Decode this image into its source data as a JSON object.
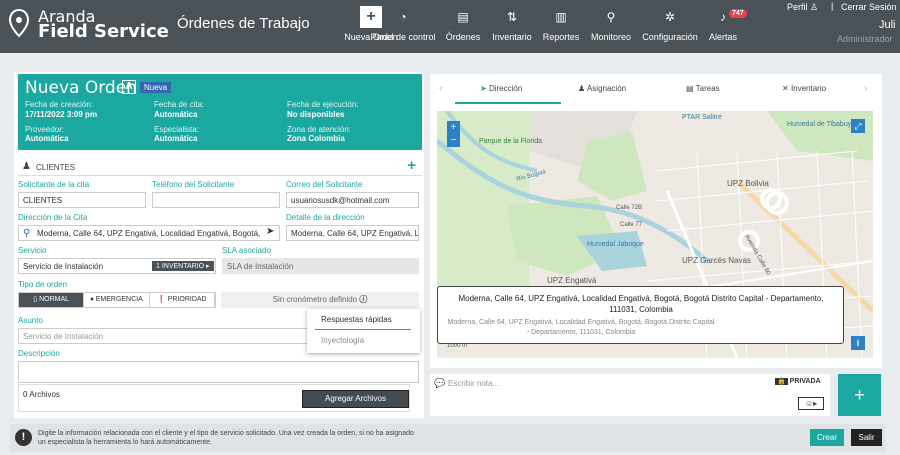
{
  "app": {
    "brand_line1": "Aranda",
    "brand_line2": "Field Service",
    "page_title": "Órdenes de Trabajo"
  },
  "nav": [
    {
      "label": "Nueva Orden",
      "icon": "plus-icon"
    },
    {
      "label": "Panel de control",
      "icon": "dashboard-icon"
    },
    {
      "label": "Órdenes",
      "icon": "orders-icon"
    },
    {
      "label": "Inventario",
      "icon": "inventory-icon"
    },
    {
      "label": "Reportes",
      "icon": "reports-icon"
    },
    {
      "label": "Monitoreo",
      "icon": "monitor-icon"
    },
    {
      "label": "Configuración",
      "icon": "gear-icon"
    },
    {
      "label": "Alertas",
      "icon": "bell-icon"
    }
  ],
  "alerts_count": "747",
  "user": {
    "perfil": "Perfil",
    "cerrar": "Cerrar Sesión",
    "name": "Juli",
    "role": "Administrador"
  },
  "order": {
    "title": "Nueva Orden",
    "letter": "A",
    "status": "Nueva",
    "creation_label": "Fecha de creación:",
    "creation_value": "17/11/2022 3:09 pm",
    "cita_label": "Fecha de cita:",
    "cita_value": "Automática",
    "ejec_label": "Fecha de ejecución:",
    "ejec_value": "No disponibles",
    "prov_label": "Proveedor:",
    "prov_value": "Automática",
    "esp_label": "Especialista:",
    "esp_value": "Automática",
    "zona_label": "Zona de atención:",
    "zona_value": "Zona Colombia"
  },
  "clientes_header": "CLIENTES",
  "form": {
    "solicitante_label": "Solicitante de la cita",
    "solicitante_value": "CLIENTES",
    "telefono_label": "Teléfono del Solicitante",
    "telefono_value": "",
    "correo_label": "Correo del Solicitante",
    "correo_value": "usuariosusdk@hotmail.com",
    "direccion_label": "Dirección de la Cita",
    "direccion_value": "Moderna, Calle 64, UPZ Engativá, Localidad Engativá, Bogotá,",
    "detalle_label": "Detalle de la dirección",
    "detalle_value": "Moderna, Calle 64, UPZ Engativá, L",
    "servicio_label": "Servicio",
    "servicio_value": "Servicio de Instalación",
    "inventario_btn": "1 INVENTARIO",
    "sla_label": "SLA asociado",
    "sla_value": "SLA de Instalación",
    "tipo_label": "Tipo de orden",
    "prioridades": [
      "NORMAL",
      "EMERGENCIA",
      "PRIORIDAD"
    ],
    "sin_cronometro": "Sin cronómetro definido",
    "asunto_label": "Asunto",
    "asunto_placeholder": "Servicio de Instalación",
    "descripcion_label": "Descripción",
    "archivos": "0 Archivos",
    "agregar": "Agregar Archivos"
  },
  "quick": {
    "title": "Respuestas rápidas",
    "item": "Inyectología"
  },
  "tabs": [
    "Dirección",
    "Asignación",
    "Tareas",
    "Inventario"
  ],
  "map": {
    "labels": [
      "Parque de la Florida",
      "Humedal Jaboque",
      "UPZ Bolivia",
      "UPZ Garcés Navas",
      "UPZ Engativá",
      "PTAR Salitre",
      "Humedal de Tibabuyes",
      "Calle 72B",
      "Calle 77",
      "Avenida Calle 80",
      "Río Bogotá",
      "1000 m"
    ],
    "addr_main": "Moderna, Calle 64, UPZ Engativá, Localidad Engativá, Bogotá, Bogotá Distrito Capital - Departamento, 111031, Colombia",
    "addr_sub": "Moderna, Calle 64, UPZ Engativá, Localidad Engativá, Bogotá, Bogotá Distrito Capital - Departamento, 111031, Colombia"
  },
  "note": {
    "placeholder": "Escribir nota...",
    "privada": "PRIVADA"
  },
  "footer": {
    "info": "Digite la información relacionada con el cliente y el tipo de servicio solicitado. Una vez creada la orden, si no ha asignado un especialista la herramienta lo hará automáticamente.",
    "crear": "Crear",
    "salir": "Salir"
  },
  "colors": {
    "primary": "#1aa8a0",
    "header": "#4a5157",
    "badge": "#e6454c"
  }
}
